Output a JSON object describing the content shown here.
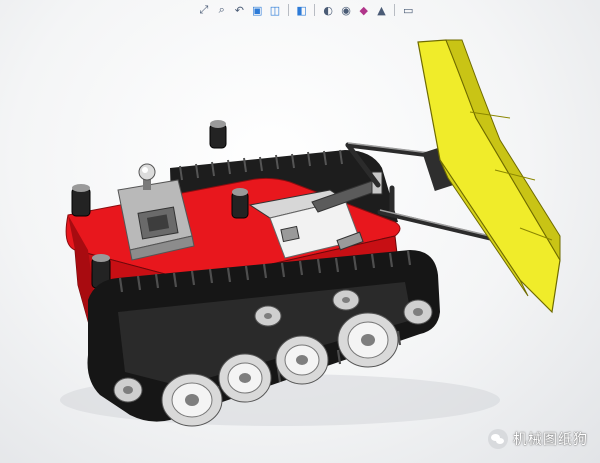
{
  "toolbar": {
    "icons": [
      "zoom-to-fit-icon",
      "zoom-area-icon",
      "previous-view-icon",
      "section-view-icon",
      "dynamic-annotation-icon",
      "view-orientation-icon",
      "display-style-icon",
      "hide-show-items-icon",
      "edit-appearance-icon",
      "apply-scene-icon",
      "view-settings-icon"
    ]
  },
  "viewport": {
    "model_colors": {
      "chassis_red": "#e8171d",
      "blade_yellow": "#e6e21a",
      "track_black": "#1b1b1b",
      "wheel_silver": "#d9d9d9",
      "background": "#f0f1f3"
    }
  },
  "watermark": {
    "text": "机械图纸狗"
  }
}
